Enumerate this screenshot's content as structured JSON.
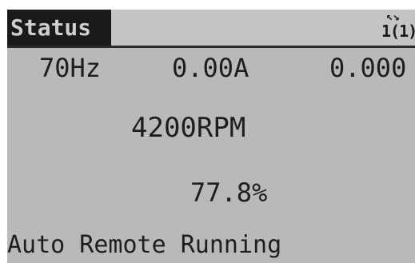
{
  "display": {
    "title": "Status",
    "setup_arrows": "↖↘",
    "setup_indicator": "1(1)",
    "readouts": {
      "frequency": "70Hz",
      "current": "0.00A",
      "power": "0.000",
      "speed": "4200RPM",
      "percent": "77.8%"
    },
    "status_line": "Auto Remote Running"
  }
}
